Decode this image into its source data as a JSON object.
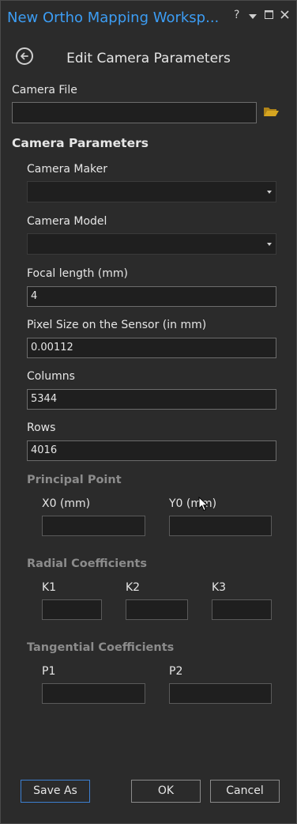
{
  "window": {
    "title": "New Ortho Mapping Worksp...",
    "help": "?",
    "controls": [
      "dropdown-icon",
      "maximize-icon",
      "close-icon"
    ]
  },
  "page_title": "Edit Camera Parameters",
  "camera_file": {
    "label": "Camera File",
    "value": ""
  },
  "camera_parameters": {
    "heading": "Camera Parameters",
    "maker_label": "Camera Maker",
    "maker_value": "",
    "model_label": "Camera Model",
    "model_value": "",
    "focal_label": "Focal length (mm)",
    "focal_value": "4",
    "pixel_label": "Pixel Size on the Sensor (in mm)",
    "pixel_value": "0.00112",
    "columns_label": "Columns",
    "columns_value": "5344",
    "rows_label": "Rows",
    "rows_value": "4016"
  },
  "principal_point": {
    "heading": "Principal Point",
    "x0_label": "X0 (mm)",
    "x0_value": "",
    "y0_label": "Y0 (mm)",
    "y0_value": ""
  },
  "radial": {
    "heading": "Radial Coefficients",
    "k1_label": "K1",
    "k2_label": "K2",
    "k3_label": "K3"
  },
  "tangential": {
    "heading": "Tangential Coefficients",
    "p1_label": "P1",
    "p2_label": "P2"
  },
  "buttons": {
    "save_as": "Save As",
    "ok": "OK",
    "cancel": "Cancel"
  },
  "colors": {
    "accent": "#3c9df4",
    "folder": "#d6a520",
    "background": "#2b2b2b"
  }
}
